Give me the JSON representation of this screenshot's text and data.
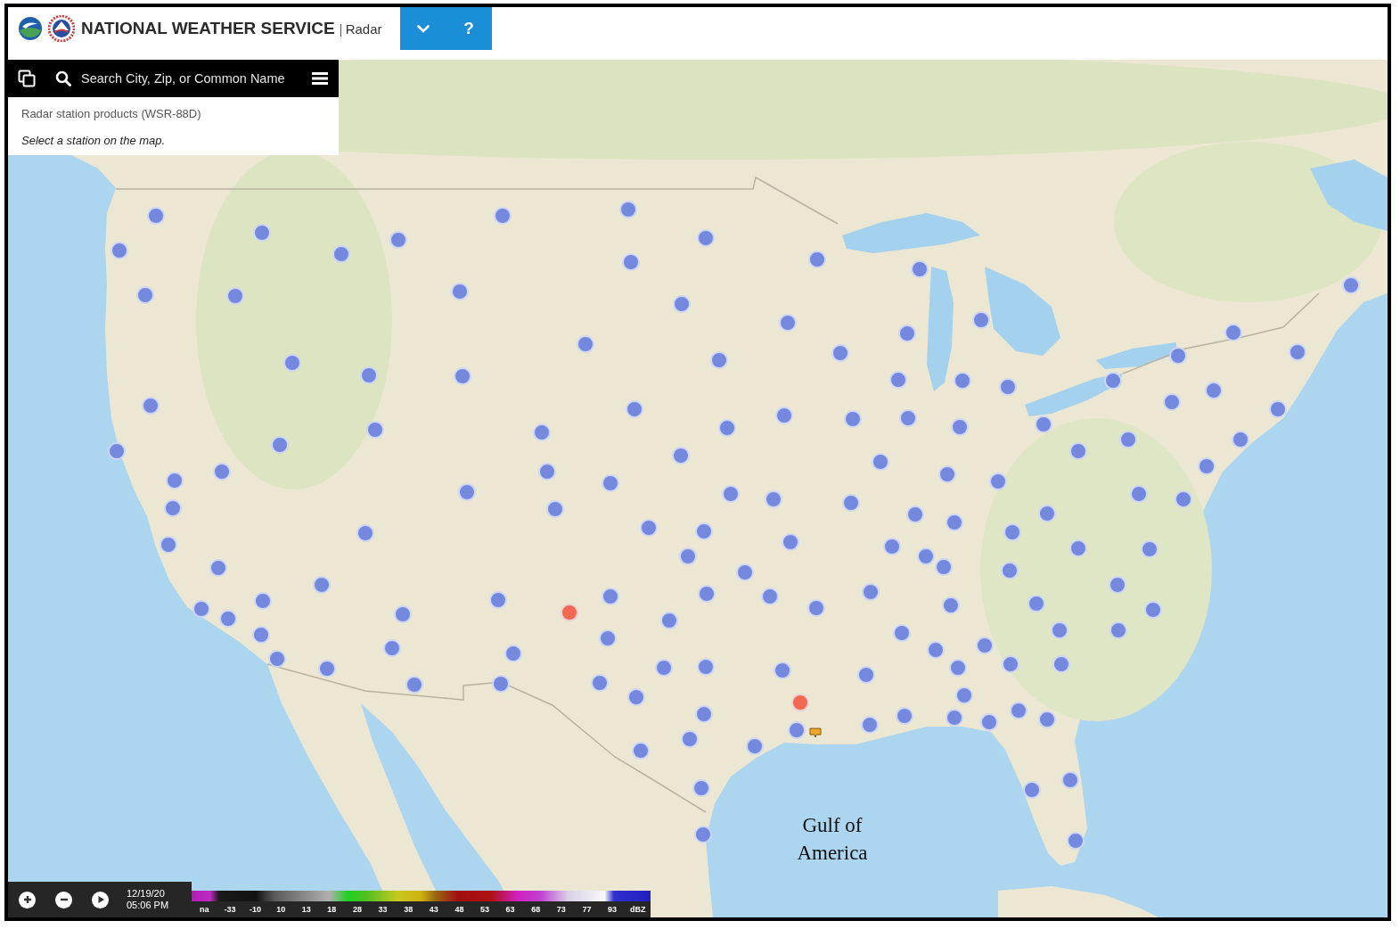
{
  "header": {
    "title": "NATIONAL WEATHER SERVICE",
    "page": "Radar",
    "help_label": "?"
  },
  "search": {
    "placeholder": "Search City, Zip, or Common Name"
  },
  "info_panel": {
    "title": "Radar station products (WSR-88D)",
    "hint": "Select a station on the map."
  },
  "map": {
    "water_label": "Gulf of America",
    "stations": [
      {
        "color": "#7489dd"
      },
      {
        "color": "#7489dd"
      },
      {
        "color": "#7489dd"
      },
      {
        "color": "#7489dd"
      },
      {
        "color": "#7489dd"
      },
      {
        "color": "#7489dd"
      },
      {
        "color": "#7489dd"
      },
      {
        "color": "#7489dd"
      },
      {
        "color": "#7489dd"
      },
      {
        "color": "#7489dd"
      },
      {
        "color": "#7489dd"
      },
      {
        "color": "#7489dd"
      },
      {
        "color": "#7489dd"
      },
      {
        "color": "#7489dd"
      },
      {
        "color": "#7489dd"
      },
      {
        "color": "#7489dd"
      },
      {
        "color": "#7489dd"
      },
      {
        "color": "#7489dd"
      },
      {
        "color": "#7489dd"
      },
      {
        "color": "#7489dd"
      },
      {
        "color": "#7489dd"
      },
      {
        "color": "#7489dd"
      },
      {
        "color": "#7489dd"
      },
      {
        "color": "#7489dd"
      },
      {
        "color": "#7489dd"
      },
      {
        "color": "#7489dd"
      },
      {
        "color": "#7489dd"
      },
      {
        "color": "#7489dd"
      },
      {
        "color": "#7489dd"
      },
      {
        "color": "#7489dd"
      },
      {
        "color": "#7489dd"
      },
      {
        "color": "#7489dd"
      },
      {
        "color": "#7489dd"
      },
      {
        "color": "#7489dd"
      },
      {
        "color": "#7489dd"
      },
      {
        "color": "#7489dd"
      },
      {
        "color": "#7489dd"
      },
      {
        "color": "#7489dd"
      },
      {
        "color": "#7489dd"
      },
      {
        "color": "#7489dd"
      },
      {
        "color": "#7489dd"
      },
      {
        "color": "#7489dd"
      },
      {
        "color": "#7489dd"
      },
      {
        "color": "#7489dd"
      },
      {
        "color": "#7489dd"
      },
      {
        "color": "#7489dd"
      },
      {
        "color": "#7489dd"
      },
      {
        "color": "#7489dd"
      },
      {
        "color": "#7489dd"
      },
      {
        "color": "#7489dd"
      },
      {
        "color": "#7489dd"
      },
      {
        "color": "#7489dd"
      },
      {
        "color": "#7489dd"
      },
      {
        "color": "#7489dd"
      },
      {
        "color": "#7489dd"
      },
      {
        "color": "#7489dd"
      },
      {
        "color": "#7489dd"
      },
      {
        "color": "#7489dd"
      },
      {
        "color": "#7489dd"
      },
      {
        "color": "#7489dd"
      },
      {
        "color": "#7489dd"
      },
      {
        "color": "#7489dd"
      },
      {
        "color": "#7489dd"
      },
      {
        "color": "#7489dd"
      },
      {
        "color": "#7489dd"
      },
      {
        "color": "#7489dd"
      },
      {
        "color": "#7489dd"
      },
      {
        "color": "#7489dd"
      },
      {
        "color": "#7489dd"
      },
      {
        "color": "#7489dd"
      },
      {
        "color": "#7489dd"
      },
      {
        "color": "#7489dd"
      },
      {
        "color": "#7489dd"
      },
      {
        "color": "#7489dd"
      },
      {
        "color": "#7489dd"
      },
      {
        "color": "#7489dd"
      },
      {
        "color": "#7489dd"
      },
      {
        "color": "#7489dd"
      },
      {
        "color": "#7489dd"
      },
      {
        "color": "#7489dd"
      },
      {
        "color": "#7489dd"
      },
      {
        "color": "#7489dd"
      },
      {
        "color": "#7489dd"
      },
      {
        "color": "#7489dd"
      },
      {
        "color": "#7489dd"
      },
      {
        "color": "#7489dd"
      },
      {
        "color": "#7489dd"
      },
      {
        "color": "#7489dd"
      },
      {
        "color": "#7489dd"
      },
      {
        "color": "#7489dd"
      },
      {
        "color": "#7489dd"
      },
      {
        "color": "#7489dd"
      },
      {
        "color": "#7489dd"
      },
      {
        "color": "#7489dd"
      },
      {
        "color": "#7489dd"
      },
      {
        "color": "#7489dd"
      },
      {
        "color": "#7489dd"
      },
      {
        "color": "#7489dd"
      },
      {
        "color": "#7489dd"
      },
      {
        "color": "#7489dd"
      },
      {
        "color": "#7489dd"
      },
      {
        "color": "#7489dd"
      },
      {
        "color": "#7489dd"
      },
      {
        "color": "#7489dd"
      },
      {
        "color": "#7489dd"
      },
      {
        "color": "#7489dd"
      },
      {
        "color": "#7489dd"
      },
      {
        "color": "#7489dd"
      },
      {
        "color": "#7489dd"
      },
      {
        "color": "#7489dd"
      },
      {
        "color": "#7489dd"
      },
      {
        "color": "#7489dd"
      },
      {
        "color": "#f26852"
      },
      {
        "color": "#7489dd"
      },
      {
        "color": "#7489dd"
      },
      {
        "color": "#7489dd"
      },
      {
        "color": "#7489dd"
      },
      {
        "color": "#7489dd"
      },
      {
        "color": "#7489dd"
      },
      {
        "color": "#7489dd"
      },
      {
        "color": "#7489dd"
      },
      {
        "color": "#7489dd"
      },
      {
        "color": "#7489dd"
      },
      {
        "color": "#7489dd"
      },
      {
        "color": "#7489dd"
      },
      {
        "color": "#7489dd"
      },
      {
        "color": "#7489dd"
      },
      {
        "color": "#7489dd"
      },
      {
        "color": "#7489dd"
      },
      {
        "color": "#7489dd"
      },
      {
        "color": "#7489dd"
      },
      {
        "color": "#f26852"
      },
      {
        "color": "#7489dd"
      },
      {
        "color": "#7489dd"
      },
      {
        "color": "#7489dd"
      },
      {
        "color": "#7489dd"
      },
      {
        "color": "#7489dd"
      },
      {
        "color": "#7489dd"
      },
      {
        "color": "#7489dd"
      },
      {
        "color": "#7489dd"
      },
      {
        "color": "#7489dd"
      },
      {
        "color": "#7489dd"
      }
    ]
  },
  "playback": {
    "date": "12/19/20",
    "time": "05:06 PM",
    "scale_labels": [
      "na",
      "-33",
      "-10",
      "10",
      "13",
      "18",
      "28",
      "33",
      "38",
      "43",
      "48",
      "53",
      "63",
      "68",
      "73",
      "77",
      "93",
      "dBZ"
    ]
  }
}
